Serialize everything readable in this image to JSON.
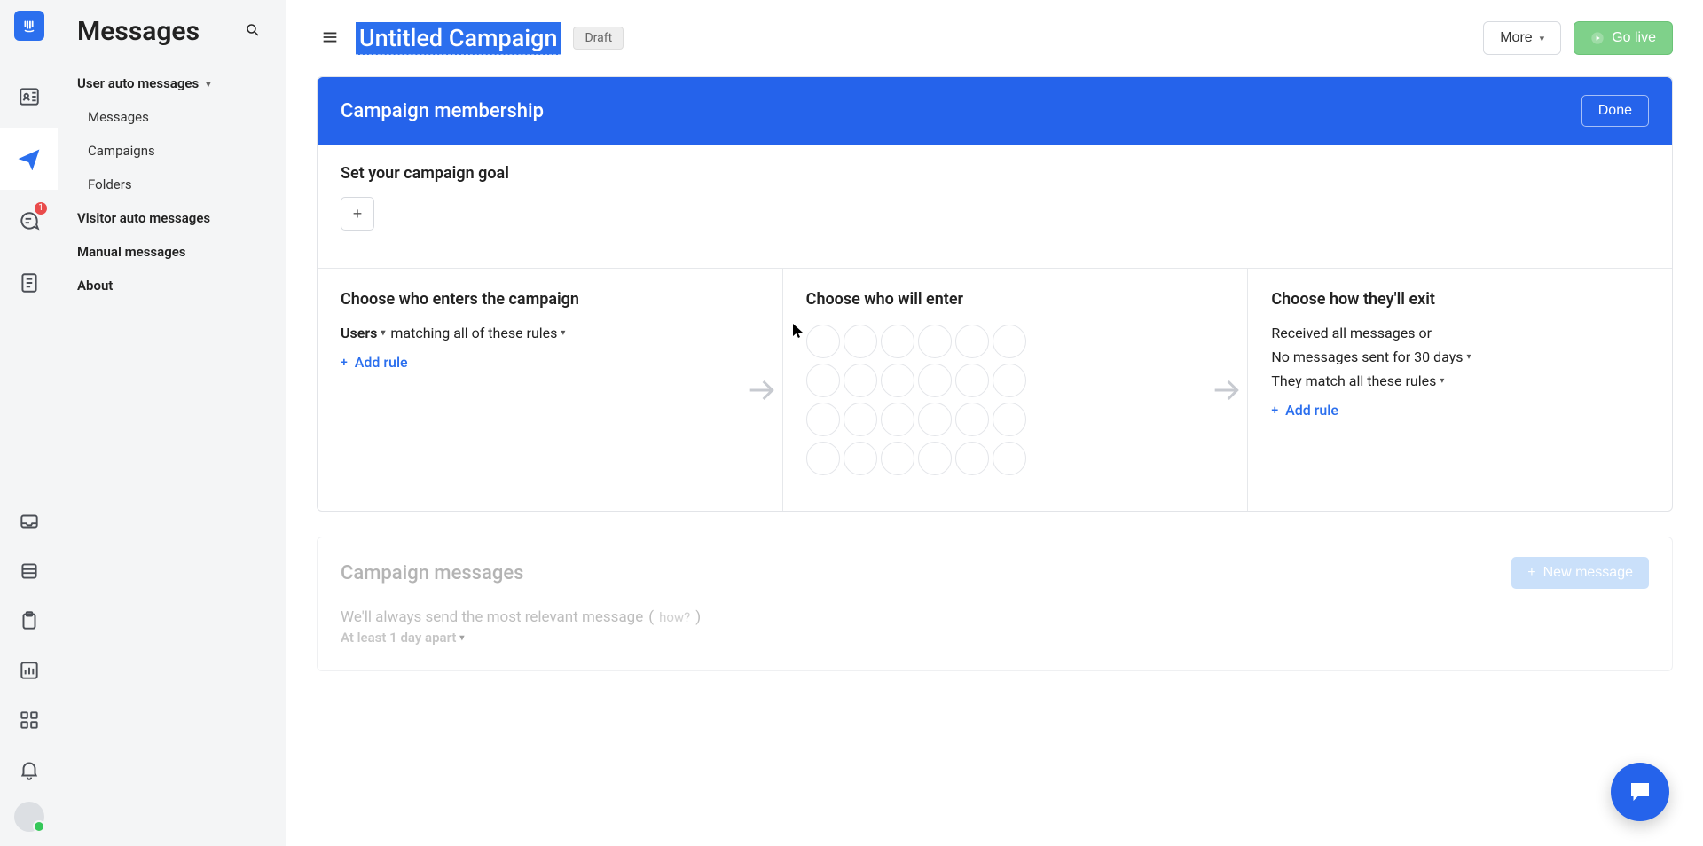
{
  "app": {
    "page_title": "Messages"
  },
  "rail": {
    "conversations_badge": "1"
  },
  "sidebar": {
    "sections": {
      "user_auto": {
        "label": "User auto messages",
        "expanded": true
      },
      "visitor_auto": {
        "label": "Visitor auto messages"
      },
      "manual": {
        "label": "Manual messages"
      },
      "about": {
        "label": "About"
      }
    },
    "user_auto_items": {
      "messages": "Messages",
      "campaigns": "Campaigns",
      "folders": "Folders"
    }
  },
  "topbar": {
    "title": "Untitled Campaign",
    "status": "Draft",
    "more_label": "More",
    "golive_label": "Go live"
  },
  "membership": {
    "header": "Campaign membership",
    "done": "Done",
    "goal_heading": "Set your campaign goal",
    "enter": {
      "heading": "Choose who enters the campaign",
      "audience": "Users",
      "match_text": "matching all of these rules",
      "add_rule": "Add rule"
    },
    "will_enter": {
      "heading": "Choose who will enter"
    },
    "exit": {
      "heading": "Choose how they'll exit",
      "line1": "Received all messages or",
      "line2": "No messages sent for 30 days",
      "line3": "They match all these rules",
      "add_rule": "Add rule"
    }
  },
  "messages_card": {
    "header": "Campaign messages",
    "new_message": "New message",
    "relevant_line": "We'll always send the most relevant message",
    "how": "how?",
    "spacing": "At least 1 day apart"
  }
}
